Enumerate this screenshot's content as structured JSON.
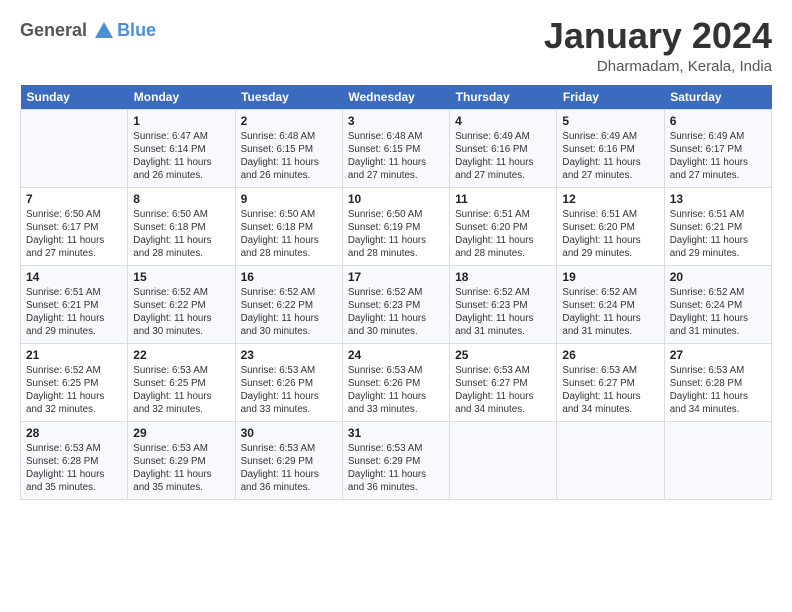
{
  "logo": {
    "line1": "General",
    "line2": "Blue"
  },
  "title": "January 2024",
  "location": "Dharmadam, Kerala, India",
  "days_header": [
    "Sunday",
    "Monday",
    "Tuesday",
    "Wednesday",
    "Thursday",
    "Friday",
    "Saturday"
  ],
  "weeks": [
    [
      {
        "num": "",
        "sunrise": "",
        "sunset": "",
        "daylight": ""
      },
      {
        "num": "1",
        "sunrise": "Sunrise: 6:47 AM",
        "sunset": "Sunset: 6:14 PM",
        "daylight": "Daylight: 11 hours and 26 minutes."
      },
      {
        "num": "2",
        "sunrise": "Sunrise: 6:48 AM",
        "sunset": "Sunset: 6:15 PM",
        "daylight": "Daylight: 11 hours and 26 minutes."
      },
      {
        "num": "3",
        "sunrise": "Sunrise: 6:48 AM",
        "sunset": "Sunset: 6:15 PM",
        "daylight": "Daylight: 11 hours and 27 minutes."
      },
      {
        "num": "4",
        "sunrise": "Sunrise: 6:49 AM",
        "sunset": "Sunset: 6:16 PM",
        "daylight": "Daylight: 11 hours and 27 minutes."
      },
      {
        "num": "5",
        "sunrise": "Sunrise: 6:49 AM",
        "sunset": "Sunset: 6:16 PM",
        "daylight": "Daylight: 11 hours and 27 minutes."
      },
      {
        "num": "6",
        "sunrise": "Sunrise: 6:49 AM",
        "sunset": "Sunset: 6:17 PM",
        "daylight": "Daylight: 11 hours and 27 minutes."
      }
    ],
    [
      {
        "num": "7",
        "sunrise": "Sunrise: 6:50 AM",
        "sunset": "Sunset: 6:17 PM",
        "daylight": "Daylight: 11 hours and 27 minutes."
      },
      {
        "num": "8",
        "sunrise": "Sunrise: 6:50 AM",
        "sunset": "Sunset: 6:18 PM",
        "daylight": "Daylight: 11 hours and 28 minutes."
      },
      {
        "num": "9",
        "sunrise": "Sunrise: 6:50 AM",
        "sunset": "Sunset: 6:18 PM",
        "daylight": "Daylight: 11 hours and 28 minutes."
      },
      {
        "num": "10",
        "sunrise": "Sunrise: 6:50 AM",
        "sunset": "Sunset: 6:19 PM",
        "daylight": "Daylight: 11 hours and 28 minutes."
      },
      {
        "num": "11",
        "sunrise": "Sunrise: 6:51 AM",
        "sunset": "Sunset: 6:20 PM",
        "daylight": "Daylight: 11 hours and 28 minutes."
      },
      {
        "num": "12",
        "sunrise": "Sunrise: 6:51 AM",
        "sunset": "Sunset: 6:20 PM",
        "daylight": "Daylight: 11 hours and 29 minutes."
      },
      {
        "num": "13",
        "sunrise": "Sunrise: 6:51 AM",
        "sunset": "Sunset: 6:21 PM",
        "daylight": "Daylight: 11 hours and 29 minutes."
      }
    ],
    [
      {
        "num": "14",
        "sunrise": "Sunrise: 6:51 AM",
        "sunset": "Sunset: 6:21 PM",
        "daylight": "Daylight: 11 hours and 29 minutes."
      },
      {
        "num": "15",
        "sunrise": "Sunrise: 6:52 AM",
        "sunset": "Sunset: 6:22 PM",
        "daylight": "Daylight: 11 hours and 30 minutes."
      },
      {
        "num": "16",
        "sunrise": "Sunrise: 6:52 AM",
        "sunset": "Sunset: 6:22 PM",
        "daylight": "Daylight: 11 hours and 30 minutes."
      },
      {
        "num": "17",
        "sunrise": "Sunrise: 6:52 AM",
        "sunset": "Sunset: 6:23 PM",
        "daylight": "Daylight: 11 hours and 30 minutes."
      },
      {
        "num": "18",
        "sunrise": "Sunrise: 6:52 AM",
        "sunset": "Sunset: 6:23 PM",
        "daylight": "Daylight: 11 hours and 31 minutes."
      },
      {
        "num": "19",
        "sunrise": "Sunrise: 6:52 AM",
        "sunset": "Sunset: 6:24 PM",
        "daylight": "Daylight: 11 hours and 31 minutes."
      },
      {
        "num": "20",
        "sunrise": "Sunrise: 6:52 AM",
        "sunset": "Sunset: 6:24 PM",
        "daylight": "Daylight: 11 hours and 31 minutes."
      }
    ],
    [
      {
        "num": "21",
        "sunrise": "Sunrise: 6:52 AM",
        "sunset": "Sunset: 6:25 PM",
        "daylight": "Daylight: 11 hours and 32 minutes."
      },
      {
        "num": "22",
        "sunrise": "Sunrise: 6:53 AM",
        "sunset": "Sunset: 6:25 PM",
        "daylight": "Daylight: 11 hours and 32 minutes."
      },
      {
        "num": "23",
        "sunrise": "Sunrise: 6:53 AM",
        "sunset": "Sunset: 6:26 PM",
        "daylight": "Daylight: 11 hours and 33 minutes."
      },
      {
        "num": "24",
        "sunrise": "Sunrise: 6:53 AM",
        "sunset": "Sunset: 6:26 PM",
        "daylight": "Daylight: 11 hours and 33 minutes."
      },
      {
        "num": "25",
        "sunrise": "Sunrise: 6:53 AM",
        "sunset": "Sunset: 6:27 PM",
        "daylight": "Daylight: 11 hours and 34 minutes."
      },
      {
        "num": "26",
        "sunrise": "Sunrise: 6:53 AM",
        "sunset": "Sunset: 6:27 PM",
        "daylight": "Daylight: 11 hours and 34 minutes."
      },
      {
        "num": "27",
        "sunrise": "Sunrise: 6:53 AM",
        "sunset": "Sunset: 6:28 PM",
        "daylight": "Daylight: 11 hours and 34 minutes."
      }
    ],
    [
      {
        "num": "28",
        "sunrise": "Sunrise: 6:53 AM",
        "sunset": "Sunset: 6:28 PM",
        "daylight": "Daylight: 11 hours and 35 minutes."
      },
      {
        "num": "29",
        "sunrise": "Sunrise: 6:53 AM",
        "sunset": "Sunset: 6:29 PM",
        "daylight": "Daylight: 11 hours and 35 minutes."
      },
      {
        "num": "30",
        "sunrise": "Sunrise: 6:53 AM",
        "sunset": "Sunset: 6:29 PM",
        "daylight": "Daylight: 11 hours and 36 minutes."
      },
      {
        "num": "31",
        "sunrise": "Sunrise: 6:53 AM",
        "sunset": "Sunset: 6:29 PM",
        "daylight": "Daylight: 11 hours and 36 minutes."
      },
      {
        "num": "",
        "sunrise": "",
        "sunset": "",
        "daylight": ""
      },
      {
        "num": "",
        "sunrise": "",
        "sunset": "",
        "daylight": ""
      },
      {
        "num": "",
        "sunrise": "",
        "sunset": "",
        "daylight": ""
      }
    ]
  ]
}
